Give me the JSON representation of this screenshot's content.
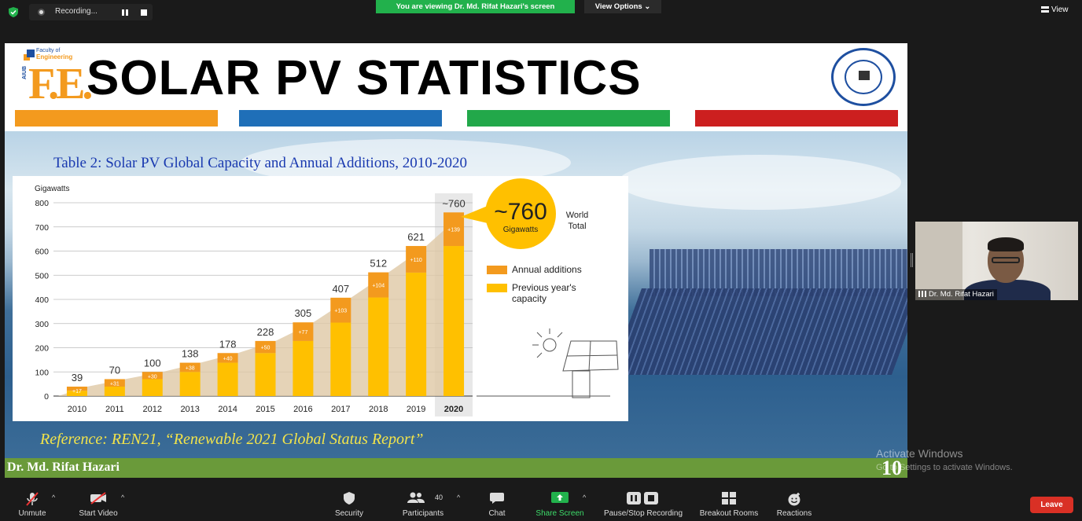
{
  "topbar": {
    "recording_label": "Recording...",
    "viewing_banner": "You are viewing Dr. Md. Rifat Hazari's screen",
    "view_options": "View Options",
    "view_options_caret": "⌄",
    "view_label": "View"
  },
  "slide": {
    "logo_small_1": "Faculty of",
    "logo_small_2": "Engineering",
    "logo_aiub": "AIUB",
    "logo_fe": "F.E.",
    "title": "SOLAR PV STATISTICS",
    "stripe_colors": [
      "#f39a1e",
      "#1f6fb8",
      "#22a84a",
      "#cc1f1f"
    ],
    "table_title": "Table 2:  Solar PV Global Capacity and Annual Additions, 2010-2020",
    "reference": "Reference: REN21, “Renewable 2021 Global Status Report”",
    "presenter": "Dr. Md. Rifat Hazari",
    "slide_number": "10"
  },
  "chart_data": {
    "type": "bar",
    "stacked": true,
    "ylabel": "Gigawatts",
    "ylim": [
      0,
      800
    ],
    "yticks": [
      "0",
      "100",
      "200",
      "300",
      "400",
      "500",
      "600",
      "700",
      "800"
    ],
    "categories": [
      "2010",
      "2011",
      "2012",
      "2013",
      "2014",
      "2015",
      "2016",
      "2017",
      "2018",
      "2019",
      "2020"
    ],
    "totals": [
      39,
      70,
      100,
      138,
      178,
      228,
      305,
      407,
      512,
      621,
      760
    ],
    "total_labels": [
      "39",
      "70",
      "100",
      "138",
      "178",
      "228",
      "305",
      "407",
      "512",
      "621",
      "~760"
    ],
    "addition_labels": [
      "+17",
      "+31",
      "+30",
      "+38",
      "+40",
      "+50",
      "+77",
      "+103",
      "+104",
      "+110",
      "+139"
    ],
    "series": [
      {
        "name": "Previous year's capacity",
        "values": [
          22,
          39,
          70,
          100,
          138,
          178,
          228,
          304,
          408,
          511,
          621
        ],
        "color": "#ffc000"
      },
      {
        "name": "Annual additions",
        "values": [
          17,
          31,
          30,
          38,
          40,
          50,
          77,
          103,
          104,
          110,
          139
        ],
        "color": "#f39a1e"
      }
    ],
    "legend": [
      "Annual additions",
      "Previous year's",
      "capacity"
    ],
    "callout_value": "~760",
    "callout_unit": "Gigawatts",
    "callout_side": [
      "World",
      "Total"
    ],
    "highlight_year": "2020"
  },
  "activate": {
    "title": "Activate Windows",
    "subtitle": "Go to Settings to activate Windows."
  },
  "participant": {
    "name": "Dr. Md. Rifat Hazari"
  },
  "toolbar": {
    "unmute": "Unmute",
    "start_video": "Start Video",
    "security": "Security",
    "participants": "Participants",
    "participants_count": "40",
    "chat": "Chat",
    "share_screen": "Share Screen",
    "pause_recording": "Pause/Stop Recording",
    "breakout_rooms": "Breakout Rooms",
    "reactions": "Reactions",
    "leave": "Leave",
    "caret": "^"
  }
}
